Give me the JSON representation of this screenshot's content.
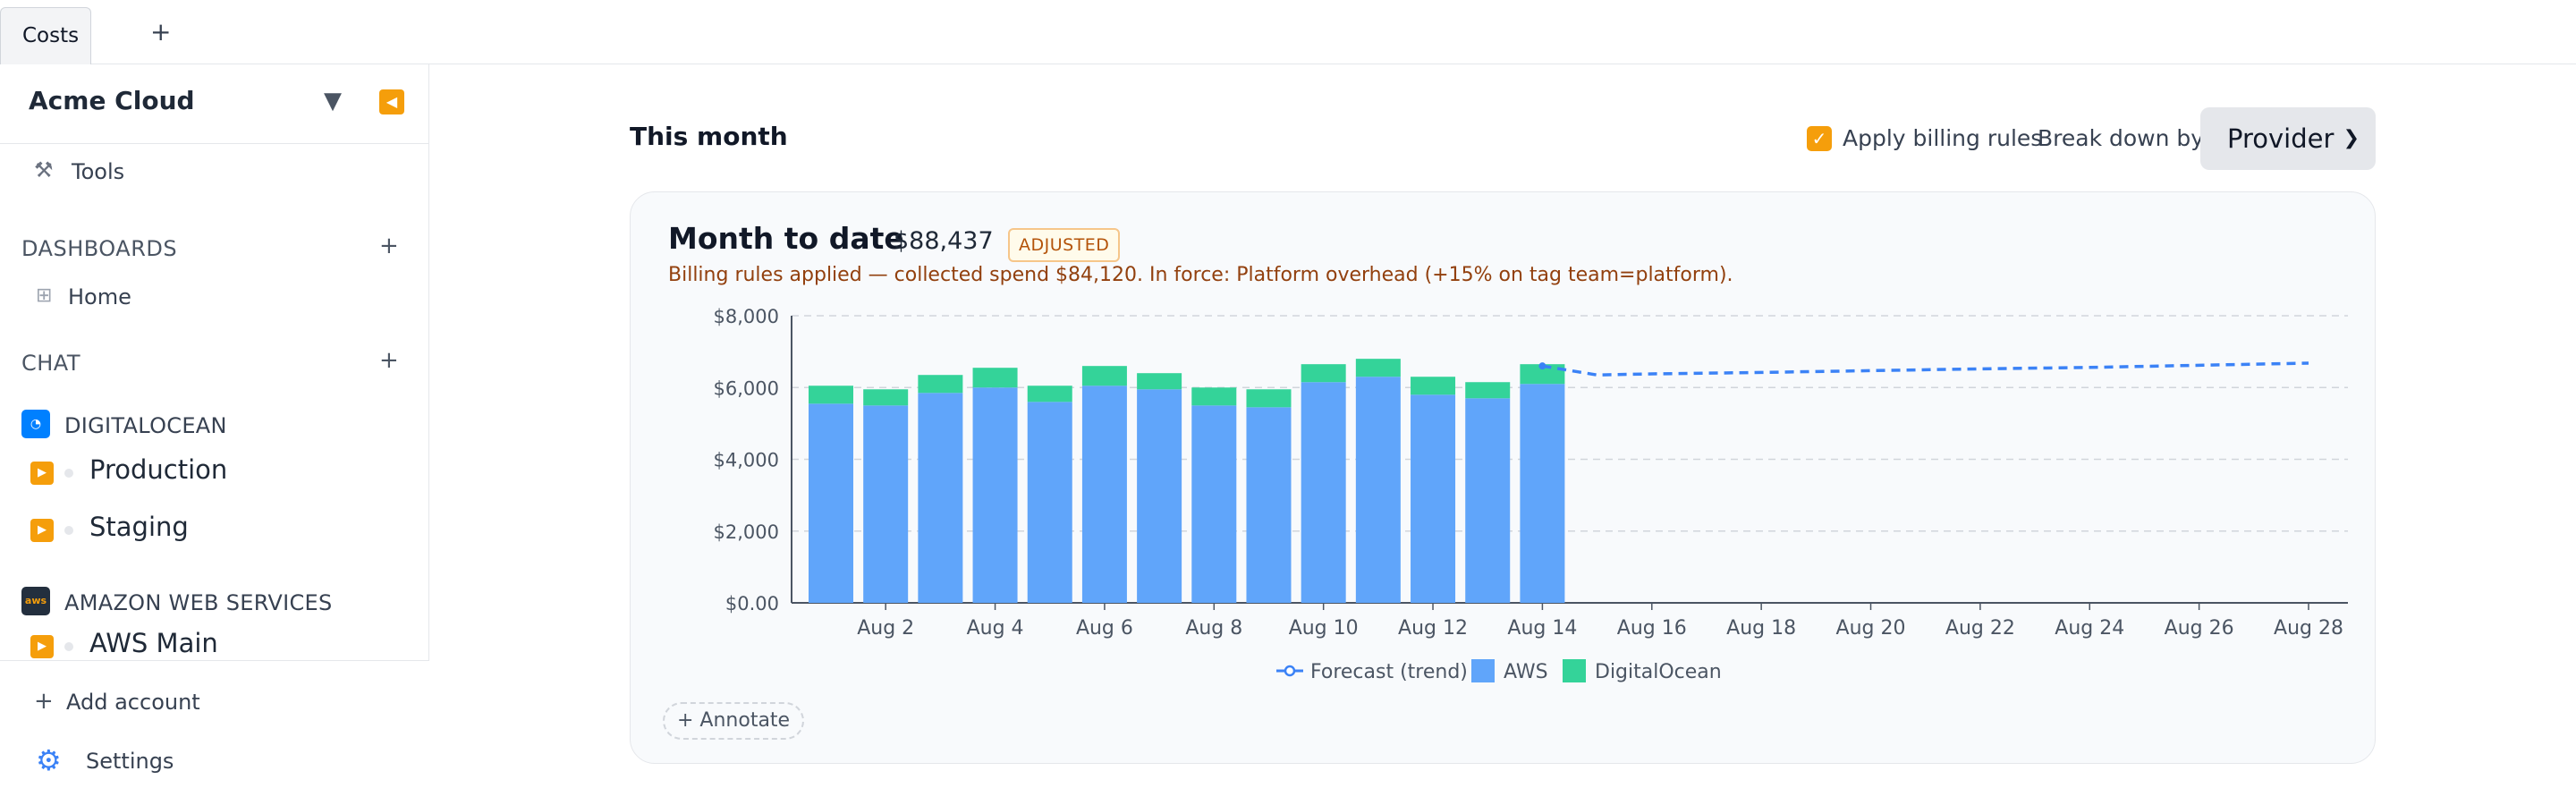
{
  "tabs": {
    "active_label": "Costs",
    "add_label": "+"
  },
  "sidebar": {
    "org_name": "Acme Cloud",
    "org_caret": "▼",
    "collapse_icon": "◀",
    "tools_label": "Tools",
    "dashboards_header": "DASHBOARDS",
    "dashboards_add": "+",
    "home_label": "Home",
    "chat_header": "CHAT",
    "chat_add": "+",
    "providers": [
      {
        "name": "DIGITALOCEAN",
        "logo_color": "#0080ff",
        "accounts": [
          "Production",
          "Staging"
        ]
      },
      {
        "name": "AMAZON WEB SERVICES",
        "logo_color": "#232f3e",
        "logo_text": "aws",
        "accounts": [
          "AWS Main"
        ]
      }
    ],
    "add_account_label": "Add account",
    "settings_label": "Settings"
  },
  "main": {
    "title": "This month",
    "apply_billing_label": "Apply billing rules",
    "apply_billing_checked": true,
    "breakdown_label": "Break down by",
    "breakdown_value": "Provider",
    "card": {
      "title": "Month to date",
      "total": "$88,437",
      "badge": "ADJUSTED",
      "note": "Billing rules applied — collected spend $84,120. In force: Platform overhead (+15% on tag team=platform).",
      "annotate_label": "+ Annotate"
    }
  },
  "colors": {
    "aws": "#60a5fa",
    "digitalocean": "#34d399",
    "forecast": "#3b82f6",
    "accent": "#f59e0b"
  },
  "chart_data": {
    "type": "bar",
    "stacked": true,
    "x": [
      "Aug 1",
      "Aug 2",
      "Aug 3",
      "Aug 4",
      "Aug 5",
      "Aug 6",
      "Aug 7",
      "Aug 8",
      "Aug 9",
      "Aug 10",
      "Aug 11",
      "Aug 12",
      "Aug 13",
      "Aug 14"
    ],
    "series": [
      {
        "name": "AWS",
        "values": [
          5550,
          5500,
          5850,
          6000,
          5600,
          6050,
          5950,
          5500,
          5450,
          6150,
          6300,
          5800,
          5700,
          6100
        ]
      },
      {
        "name": "DigitalOcean",
        "values": [
          500,
          450,
          500,
          550,
          450,
          550,
          450,
          500,
          500,
          500,
          500,
          500,
          450,
          550
        ]
      }
    ],
    "forecast": {
      "name": "Forecast (trend)",
      "x": [
        "Aug 14",
        "Aug 15",
        "Aug 16",
        "Aug 18",
        "Aug 20",
        "Aug 22",
        "Aug 24",
        "Aug 26",
        "Aug 28"
      ],
      "values": [
        6600,
        6350,
        6380,
        6420,
        6470,
        6520,
        6560,
        6620,
        6680
      ]
    },
    "y_ticks": [
      "$0.00",
      "$2,000",
      "$4,000",
      "$6,000",
      "$8,000"
    ],
    "x_ticks": [
      "Aug 2",
      "Aug 4",
      "Aug 6",
      "Aug 8",
      "Aug 10",
      "Aug 12",
      "Aug 14",
      "Aug 16",
      "Aug 18",
      "Aug 20",
      "Aug 22",
      "Aug 24",
      "Aug 26",
      "Aug 28"
    ],
    "ylim": [
      0,
      8000
    ],
    "xlim_days": [
      1,
      28
    ],
    "grid": true,
    "legend_placement": "bottom-center",
    "legend": [
      "Forecast (trend)",
      "AWS",
      "DigitalOcean"
    ]
  }
}
